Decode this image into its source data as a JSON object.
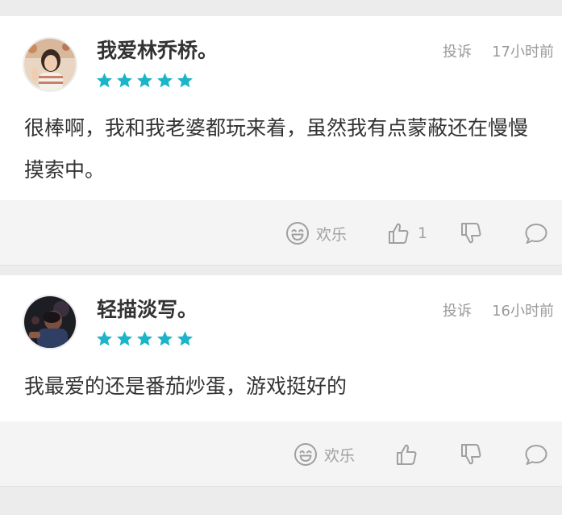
{
  "comments": [
    {
      "username": "我爱林乔桥。",
      "rating": 5,
      "report_label": "投诉",
      "time": "17小时前",
      "content": "很棒啊，我和我老婆都玩来着，虽然我有点蒙蔽还在慢慢摸索中。",
      "reaction_label": "欢乐",
      "like_count": "1"
    },
    {
      "username": "轻描淡写。",
      "rating": 5,
      "report_label": "投诉",
      "time": "16小时前",
      "content": "我最爱的还是番茄炒蛋，游戏挺好的",
      "reaction_label": "欢乐",
      "like_count": ""
    }
  ],
  "colors": {
    "star": "#1bb5c9",
    "muted": "#999999",
    "text": "#333333"
  },
  "icons": [
    "smiley-icon",
    "thumbs-up-icon",
    "thumbs-down-icon",
    "speech-bubble-icon"
  ]
}
